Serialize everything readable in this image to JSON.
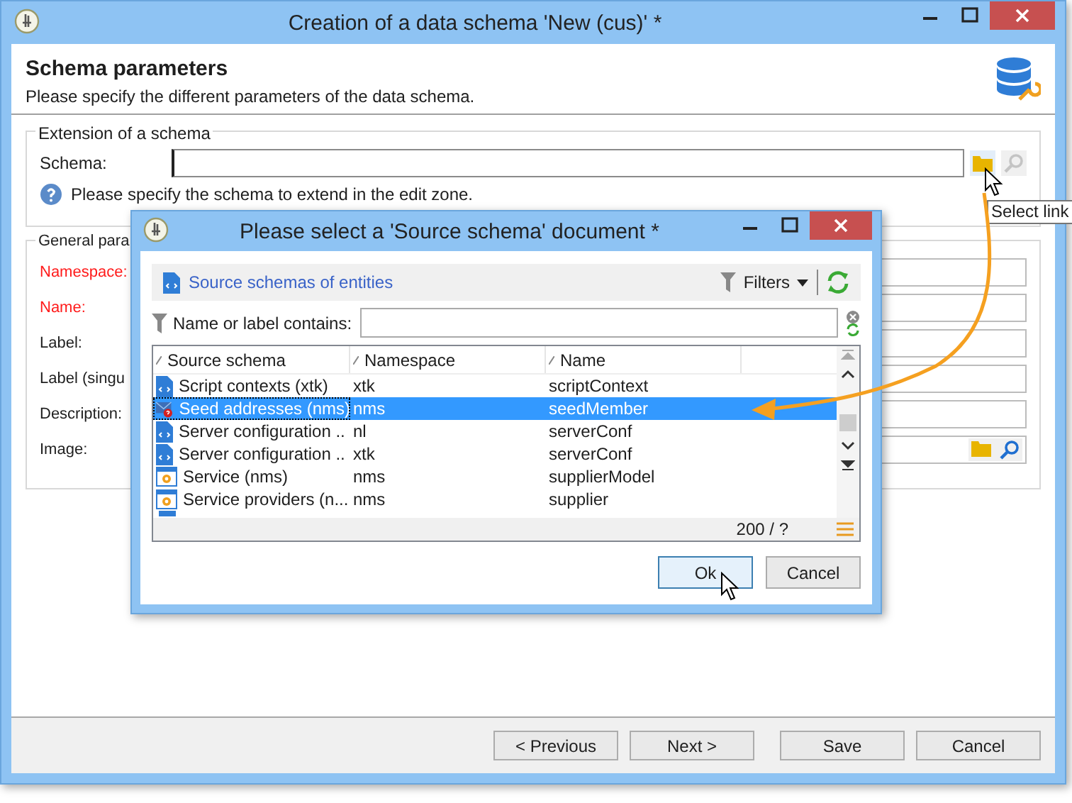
{
  "main_window": {
    "title": "Creation of a data schema 'New (cus)' *",
    "heading": "Schema parameters",
    "subheading": "Please specify the different parameters of the data schema.",
    "extension_group": {
      "legend": "Extension of a schema",
      "schema_label": "Schema:",
      "help": "Please specify the schema to extend in the edit zone."
    },
    "tooltip": "Select link",
    "general_group": {
      "legend": "General para",
      "fields": [
        {
          "label": "Namespace:",
          "required": true,
          "kind": "text"
        },
        {
          "label": "Name:",
          "required": true,
          "kind": "text"
        },
        {
          "label": "Label:",
          "required": false,
          "kind": "text"
        },
        {
          "label": "Label (singu",
          "required": false,
          "kind": "text"
        },
        {
          "label": "Description:",
          "required": false,
          "kind": "text"
        },
        {
          "label": "Image:",
          "required": false,
          "kind": "image"
        }
      ]
    },
    "buttons": [
      "< Previous",
      "Next >",
      "Save",
      "Cancel"
    ]
  },
  "dialog": {
    "title": "Please select a 'Source schema' document *",
    "folder": "Source schemas of entities",
    "filters": "Filters",
    "filter_label": "Name or label contains:",
    "columns": [
      "Source schema",
      "Namespace",
      "Name"
    ],
    "rows": [
      {
        "kind": "document",
        "source_schema": "Script contexts (xtk)",
        "namespace": "xtk",
        "name": "scriptContext",
        "selected": false
      },
      {
        "kind": "seed",
        "source_schema": "Seed addresses (nms)",
        "namespace": "nms",
        "name": "seedMember",
        "selected": true
      },
      {
        "kind": "document",
        "source_schema": "Server configuration ..",
        "namespace": "nl",
        "name": "serverConf",
        "selected": false
      },
      {
        "kind": "document",
        "source_schema": "Server configuration ..",
        "namespace": "xtk",
        "name": "serverConf",
        "selected": false
      },
      {
        "kind": "service",
        "source_schema": "Service (nms)",
        "namespace": "nms",
        "name": "supplierModel",
        "selected": false
      },
      {
        "kind": "service",
        "source_schema": "Service providers (n...",
        "namespace": "nms",
        "name": "supplier",
        "selected": false
      }
    ],
    "count": "200 / ?",
    "buttons": [
      "Ok",
      "Cancel"
    ]
  }
}
